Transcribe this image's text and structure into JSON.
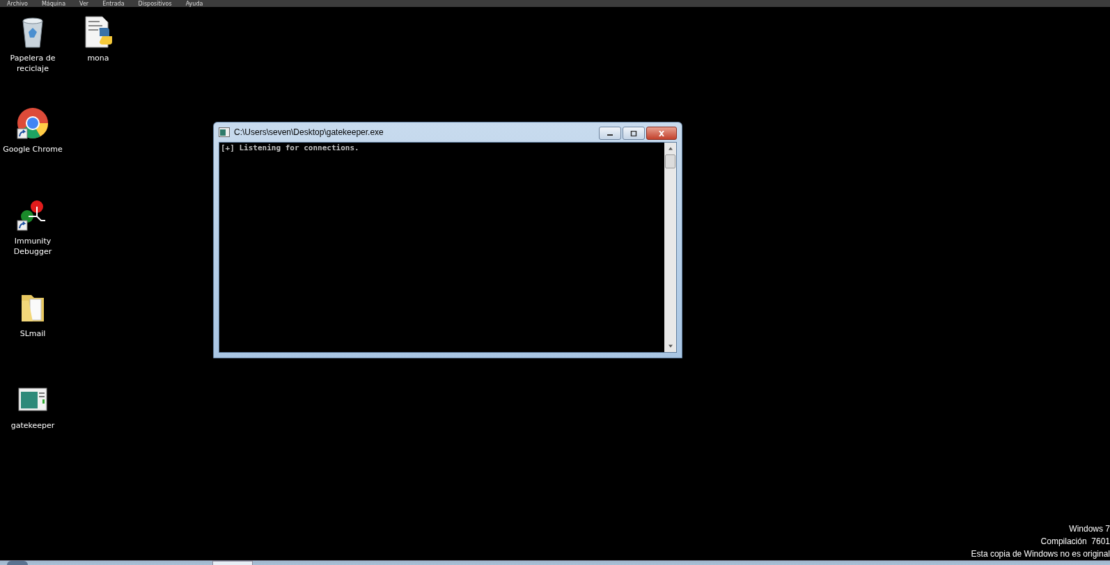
{
  "menu_bar": {
    "items": [
      "Archivo",
      "Máquina",
      "Ver",
      "Entrada",
      "Dispositivos",
      "Ayuda"
    ]
  },
  "desktop_icons": [
    {
      "label": "Papelera de reciclaje",
      "kind": "recycle-bin",
      "shortcut": false
    },
    {
      "label": "mona",
      "kind": "python-script",
      "shortcut": false
    },
    {
      "label": "Google Chrome",
      "kind": "chrome",
      "shortcut": true
    },
    {
      "label": "Immunity Debugger",
      "kind": "debugger",
      "shortcut": true
    },
    {
      "label": "SLmail",
      "kind": "folder",
      "shortcut": false
    },
    {
      "label": "gatekeeper",
      "kind": "app",
      "shortcut": false
    }
  ],
  "console_window": {
    "title": "C:\\Users\\seven\\Desktop\\gatekeeper.exe",
    "lines": [
      "[+] Listening for connections."
    ]
  },
  "activation_notice": [
    "Windows 7",
    "Compilación  7601",
    "Esta copia de Windows no es original"
  ]
}
